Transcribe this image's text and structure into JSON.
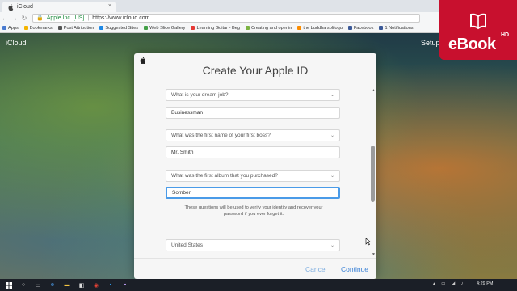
{
  "browser": {
    "tab_title": "iCloud",
    "tab_close": "×",
    "site_identity": "Apple Inc. [US]",
    "url": "https://www.icloud.com",
    "bookmarks": [
      {
        "label": "Apps",
        "color": "#4a7bd0"
      },
      {
        "label": "Bookmarks",
        "color": "#f4b400"
      },
      {
        "label": "Post Attribution",
        "color": "#555555"
      },
      {
        "label": "Suggested Sites",
        "color": "#1e88e5"
      },
      {
        "label": "Web Slice Gallery",
        "color": "#43a047"
      },
      {
        "label": "Learning Guitar - Beg",
        "color": "#e53935"
      },
      {
        "label": "Creating and openin",
        "color": "#7cb342"
      },
      {
        "label": "the buddha soliloqu",
        "color": "#fb8c00"
      },
      {
        "label": "Facebook",
        "color": "#3b5998"
      },
      {
        "label": "1 Notifications",
        "color": "#3b5998"
      }
    ]
  },
  "page": {
    "brand": "iCloud",
    "setup": "Setup"
  },
  "modal": {
    "title": "Create Your Apple ID",
    "question1": "What is your dream job?",
    "answer1": "Businessman",
    "question2": "What was the first name of your first boss?",
    "answer2": "Mr. Smith",
    "question3": "What was the first album that you purchased?",
    "answer3": "Somber",
    "helper_text": "These questions will be used to verify your identity and recover your password if you ever forget it.",
    "country": "United States",
    "cancel": "Cancel",
    "continue": "Continue"
  },
  "badge": {
    "text": "eBook",
    "hd": "HD"
  },
  "taskbar": {
    "time": "4:29 PM"
  },
  "colors": {
    "accent": "#3b82d6",
    "focus": "#4a9be8",
    "badge": "#c8102e"
  }
}
